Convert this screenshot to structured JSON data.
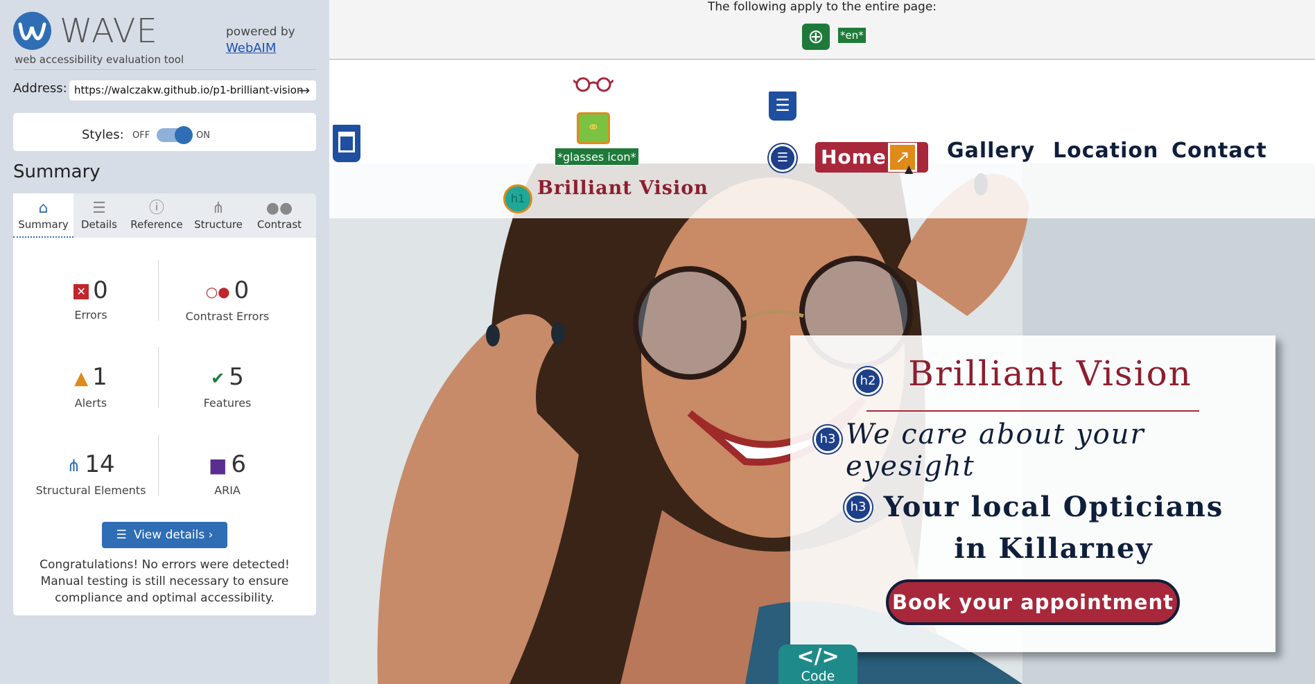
{
  "sidebar": {
    "brand": "WAVE",
    "tagline": "web accessibility evaluation tool",
    "powered_by": "powered by",
    "powered_link": "WebAIM",
    "address_label": "Address:",
    "address_value": "https://walczakw.github.io/p1-brilliant-vision",
    "styles_label": "Styles:",
    "styles_off": "OFF",
    "styles_on": "ON",
    "styles_enabled": true,
    "summary_heading": "Summary",
    "tabs": [
      {
        "label": "Summary",
        "icon": "home-icon",
        "active": true
      },
      {
        "label": "Details",
        "icon": "list-icon",
        "active": false
      },
      {
        "label": "Reference",
        "icon": "info-icon",
        "active": false
      },
      {
        "label": "Structure",
        "icon": "sitemap-icon",
        "active": false
      },
      {
        "label": "Contrast",
        "icon": "contrast-icon",
        "active": false
      }
    ],
    "stats": {
      "errors": {
        "count": "0",
        "label": "Errors"
      },
      "contrast_errors": {
        "count": "0",
        "label": "Contrast Errors"
      },
      "alerts": {
        "count": "1",
        "label": "Alerts"
      },
      "features": {
        "count": "5",
        "label": "Features"
      },
      "structural": {
        "count": "14",
        "label": "Structural Elements"
      },
      "aria": {
        "count": "6",
        "label": "ARIA"
      }
    },
    "view_details": "View details ›",
    "congrats": "Congratulations! No errors were detected! Manual testing is still necessary to ensure compliance and optimal accessibility."
  },
  "page": {
    "apply_text": "The following apply to the entire page:",
    "lang_badge": "*en*",
    "glasses_label": "*glasses icon*",
    "brand_small": "Brilliant Vision",
    "nav": {
      "home": "Home",
      "gallery": "Gallery",
      "location": "Location",
      "contact": "Contact"
    },
    "card": {
      "h2_badge": "h2",
      "title": "Brilliant Vision",
      "h3_badge": "h3",
      "subtitle": "We care about your eyesight",
      "tagline": "Your local Opticians in Killarney",
      "button": "Book your appointment"
    },
    "h1_badge": "h1",
    "code_tab": "Code",
    "code_icon": "</>"
  },
  "colors": {
    "wave_blue": "#2f6db5",
    "brand_red": "#a8273a",
    "navy": "#0f1e3a",
    "feature_green": "#1f7a3a",
    "error_red": "#c0262d",
    "alert_orange": "#e08a1a"
  }
}
